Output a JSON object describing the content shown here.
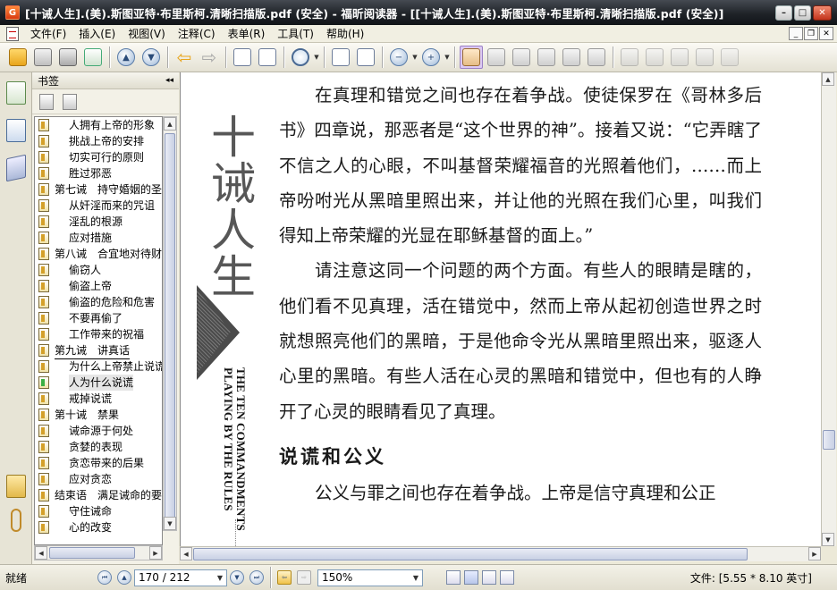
{
  "window": {
    "title": "[十诫人生].(美).斯图亚特·布里斯柯.清晰扫描版.pdf (安全) - 福昕阅读器 - [[十诫人生].(美).斯图亚特·布里斯柯.清晰扫描版.pdf (安全)]",
    "minimize": "–",
    "maximize": "□",
    "close": "✕"
  },
  "menu": {
    "items": [
      "文件(F)",
      "插入(E)",
      "视图(V)",
      "注释(C)",
      "表单(R)",
      "工具(T)",
      "帮助(H)"
    ]
  },
  "panel": {
    "title": "书签",
    "collapse_glyph": "◂◂"
  },
  "bookmarks": [
    {
      "label": "人拥有上帝的形象",
      "level": 2
    },
    {
      "label": "挑战上帝的安排",
      "level": 2
    },
    {
      "label": "切实可行的原则",
      "level": 2
    },
    {
      "label": "胜过邪恶",
      "level": 2
    },
    {
      "label": "第七诫　持守婚姻的圣",
      "level": 1
    },
    {
      "label": "从奸淫而来的咒诅",
      "level": 2
    },
    {
      "label": "淫乱的根源",
      "level": 2
    },
    {
      "label": "应对措施",
      "level": 2
    },
    {
      "label": "第八诫　合宜地对待财",
      "level": 1
    },
    {
      "label": "偷窃人",
      "level": 2
    },
    {
      "label": "偷盗上帝",
      "level": 2
    },
    {
      "label": "偷盗的危险和危害",
      "level": 2
    },
    {
      "label": "不要再偷了",
      "level": 2
    },
    {
      "label": "工作带来的祝福",
      "level": 2
    },
    {
      "label": "第九诫　讲真话",
      "level": 1,
      "underline": true
    },
    {
      "label": "为什么上帝禁止说谎",
      "level": 2
    },
    {
      "label": "人为什么说谎",
      "level": 2,
      "selected": true
    },
    {
      "label": "戒掉说谎",
      "level": 2
    },
    {
      "label": "第十诫　禁果",
      "level": 1
    },
    {
      "label": "诫命源于何处",
      "level": 2
    },
    {
      "label": "贪婪的表现",
      "level": 2
    },
    {
      "label": "贪恋带来的后果",
      "level": 2
    },
    {
      "label": "应对贪恋",
      "level": 2
    },
    {
      "label": "结束语　满足诫命的要",
      "level": 1
    },
    {
      "label": "守住诫命",
      "level": 2
    },
    {
      "label": "心的改变",
      "level": 2
    }
  ],
  "page": {
    "cover_calligraphy": "十诫人生",
    "cover_english_1": "THE TEN COMMANDMENTS",
    "cover_english_2": "PLAYING BY THE RULES",
    "para1": "在真理和错觉之间也存在着争战。使徒保罗在《哥林多后书》四章说，那恶者是“这个世界的神”。接着又说：“它弄瞎了不信之人的心眼，不叫基督荣耀福音的光照着他们，……而上帝吩咐光从黑暗里照出来，并让他的光照在我们心里，叫我们得知上帝荣耀的光显在耶稣基督的面上。”",
    "para2": "请注意这同一个问题的两个方面。有些人的眼睛是瞎的，他们看不见真理，活在错觉中，然而上帝从起初创造世界之时就想照亮他们的黑暗，于是他命令光从黑暗里照出来，驱逐人心里的黑暗。有些人活在心灵的黑暗和错觉中，但也有的人睁开了心灵的眼睛看见了真理。",
    "heading": "说谎和公义",
    "para3": "公义与罪之间也存在着争战。上帝是信守真理和公正"
  },
  "status": {
    "ready": "就绪",
    "page_field": "170 / 212",
    "zoom_field": "150%",
    "doc_size": "文件: [5.55 * 8.10 英寸]"
  }
}
